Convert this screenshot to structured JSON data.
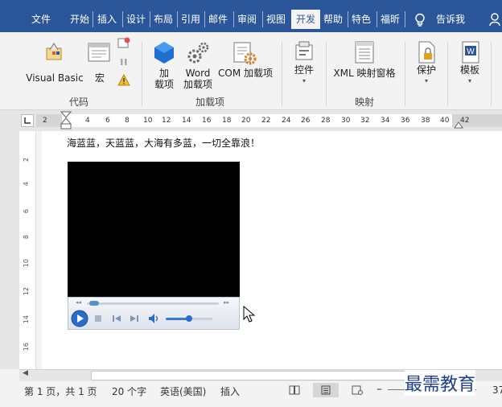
{
  "menu": {
    "tabs": [
      "文件",
      "开始",
      "插入",
      "设计",
      "布局",
      "引用",
      "邮件",
      "审阅",
      "视图",
      "开发",
      "帮助",
      "特色",
      "福昕",
      "告诉我"
    ],
    "active": "开发"
  },
  "ribbon": {
    "visual_basic": "Visual Basic",
    "macro": "宏",
    "addin_line1": "加",
    "addin_line2": "载项",
    "word_addin_line1": "Word",
    "word_addin_line2": "加载项",
    "com_addin": "COM 加载项",
    "controls": "控件",
    "xml_mapping": "XML 映射窗格",
    "protect": "保护",
    "template": "模板",
    "group_code": "代码",
    "group_addins": "加载项",
    "group_mapping": "映射"
  },
  "ruler": {
    "ticks": [
      "2",
      "2",
      "4",
      "6",
      "8",
      "10",
      "12",
      "14",
      "16",
      "18",
      "20",
      "22",
      "24",
      "26",
      "28",
      "30",
      "32",
      "34",
      "36",
      "38",
      "40",
      "42"
    ]
  },
  "vruler": {
    "ticks": [
      "2",
      "4",
      "6",
      "8",
      "10",
      "12",
      "14",
      "16"
    ]
  },
  "document": {
    "text": "海蓝蓝，天蓝蓝，大海有多蓝，一切全靠浪！"
  },
  "status": {
    "page": "第 1 页，共 1 页",
    "words": "20 个字",
    "language": "英语(美国)",
    "mode": "插入",
    "zoom_tail": "37"
  },
  "watermark": "最需教育",
  "colors": {
    "menubar": "#2b579a",
    "ribbon": "#f3f3f3",
    "player_bg": "#000000"
  }
}
